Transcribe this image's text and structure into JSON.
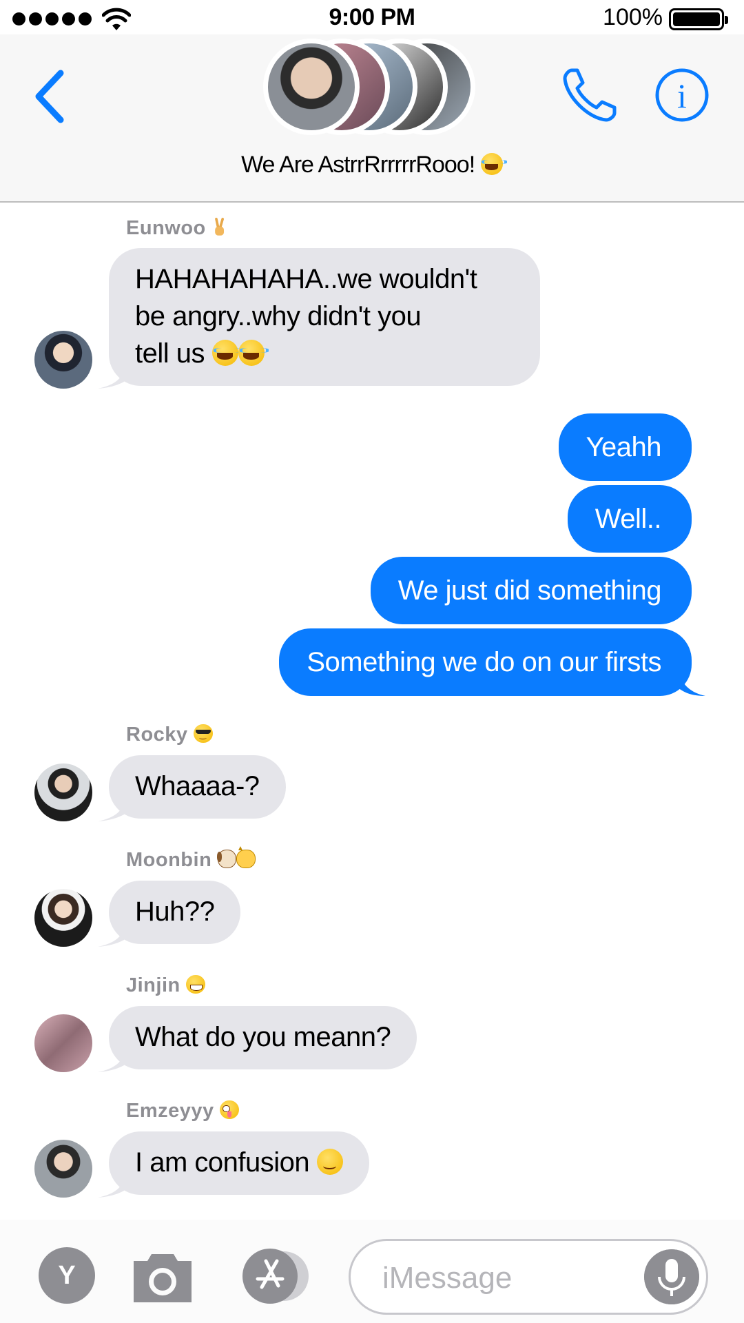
{
  "status_bar": {
    "time": "9:00 PM",
    "battery_percent": "100%",
    "signal_bars": 5
  },
  "header": {
    "group_name": "We Are AstrrRrrrrrRooo!",
    "back_icon": "chevron-left-icon",
    "call_icon": "phone-icon",
    "info_icon": "info-icon",
    "accent_color": "#0a7cff"
  },
  "messages": [
    {
      "sender": "Eunwoo",
      "direction": "in",
      "text_lines": [
        "HAHAHAHAHA..we wouldn't",
        "be angry..why didn't you",
        "tell us"
      ]
    },
    {
      "direction": "out",
      "text": "Yeahh"
    },
    {
      "direction": "out",
      "text": "Well.."
    },
    {
      "direction": "out",
      "text": "We just did something"
    },
    {
      "direction": "out",
      "text": "Something we do on our firsts"
    },
    {
      "sender": "Rocky",
      "direction": "in",
      "text": "Whaaaa-?"
    },
    {
      "sender": "Moonbin",
      "direction": "in",
      "text": "Huh??"
    },
    {
      "sender": "Jinjin",
      "direction": "in",
      "text": "What do you meann?"
    },
    {
      "sender": "Emzeyyy",
      "direction": "in",
      "text": "I am confusion"
    }
  ],
  "composer": {
    "contact_initial": "Y",
    "placeholder": "iMessage",
    "camera_icon": "camera-icon",
    "apps_icon": "app-store-icon",
    "mic_icon": "microphone-icon"
  },
  "colors": {
    "incoming_bubble": "#e5e5ea",
    "outgoing_bubble": "#0a7cff",
    "sender_label": "#8e8e93"
  }
}
